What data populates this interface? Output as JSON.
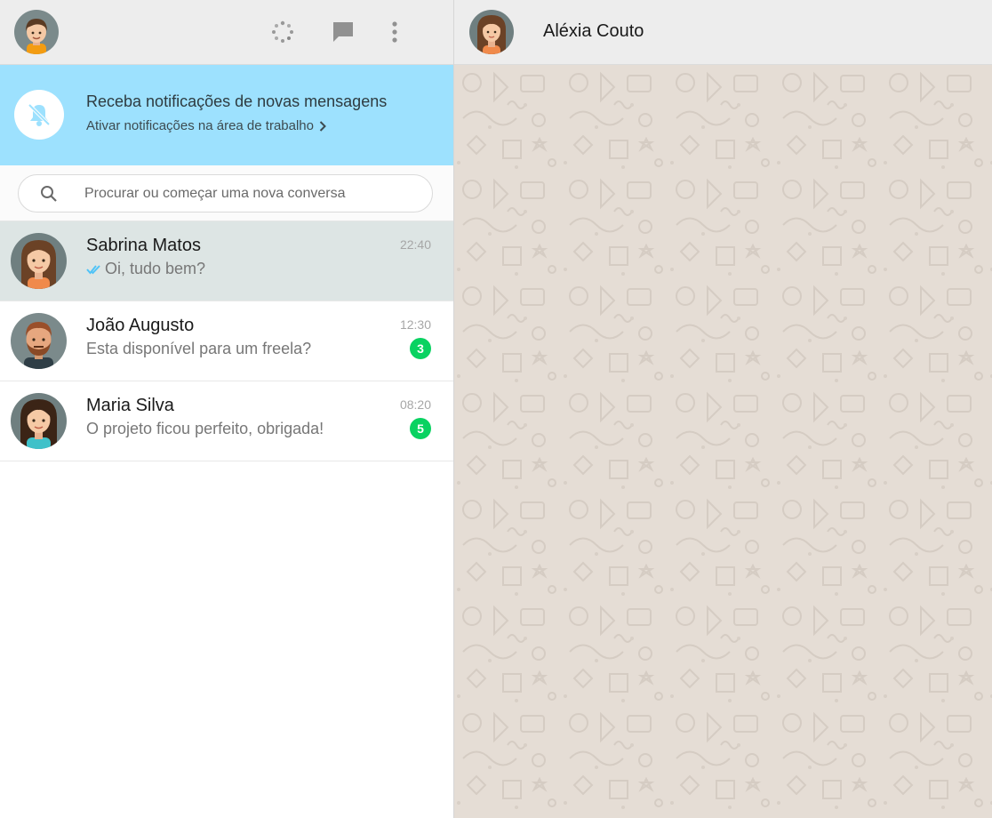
{
  "topbar": {
    "icons": [
      "status-icon",
      "new-chat-icon",
      "menu-icon"
    ]
  },
  "notification": {
    "title": "Receba notificações de novas mensagens",
    "link": "Ativar notificações na área de trabalho"
  },
  "search": {
    "placeholder": "Procurar ou começar uma nova conversa"
  },
  "chats": [
    {
      "name": "Sabrina Matos",
      "time": "22:40",
      "message": "Oi, tudo bem?",
      "read_ticks": true,
      "unread": ""
    },
    {
      "name": "João Augusto",
      "time": "12:30",
      "message": "Esta disponível para um freela?",
      "read_ticks": false,
      "unread": "3"
    },
    {
      "name": "Maria Silva",
      "time": "08:20",
      "message": "O projeto ficou perfeito, obrigada!",
      "read_ticks": false,
      "unread": "5"
    }
  ],
  "conversation": {
    "contact_name": "Aléxia Couto"
  },
  "colors": {
    "notification_bg": "#9de1fe",
    "unread_badge": "#09d261",
    "read_tick": "#4fc3f7",
    "wallpaper": "#e5ddd5",
    "active_row": "#dde5e4"
  }
}
